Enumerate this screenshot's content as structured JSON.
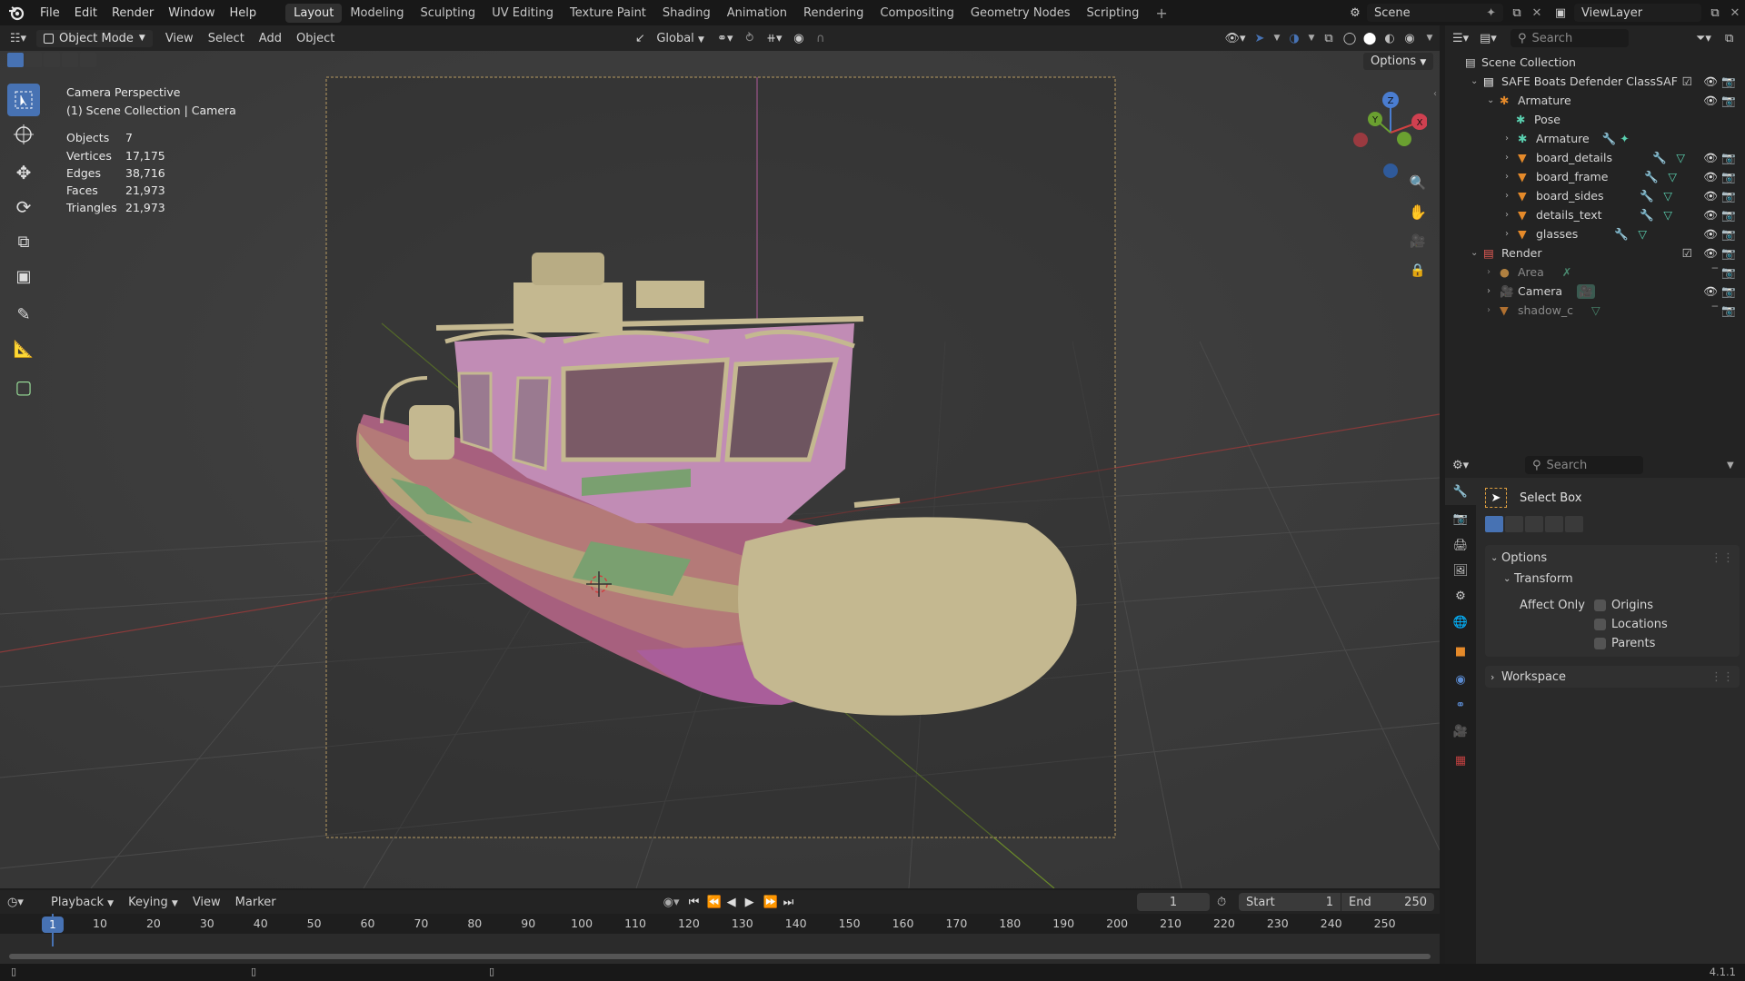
{
  "app": {
    "menus": [
      "File",
      "Edit",
      "Render",
      "Window",
      "Help"
    ]
  },
  "workspaces": [
    "Layout",
    "Modeling",
    "Sculpting",
    "UV Editing",
    "Texture Paint",
    "Shading",
    "Animation",
    "Rendering",
    "Compositing",
    "Geometry Nodes",
    "Scripting"
  ],
  "active_workspace": "Layout",
  "scene": {
    "name": "Scene",
    "view_layer": "ViewLayer"
  },
  "viewport": {
    "mode": "Object Mode",
    "menus": [
      "View",
      "Select",
      "Add",
      "Object"
    ],
    "transform_orientation": "Global",
    "options_label": "Options",
    "overlay_title": "Camera Perspective",
    "overlay_subtitle": "(1) Scene Collection | Camera",
    "stats": [
      {
        "label": "Objects",
        "value": "7"
      },
      {
        "label": "Vertices",
        "value": "17,175"
      },
      {
        "label": "Edges",
        "value": "38,716"
      },
      {
        "label": "Faces",
        "value": "21,973"
      },
      {
        "label": "Triangles",
        "value": "21,973"
      }
    ],
    "gizmo": {
      "z": "Z",
      "y": "Y",
      "x": "X"
    }
  },
  "outliner": {
    "search_placeholder": "Search",
    "root": "Scene Collection",
    "rows": [
      {
        "label": "SAFE Boats Defender ClassSAF",
        "type": "collection",
        "indent": 0
      },
      {
        "label": "Armature",
        "type": "armature",
        "indent": 1
      },
      {
        "label": "Pose",
        "type": "pose",
        "indent": 2
      },
      {
        "label": "Armature",
        "type": "armature-data",
        "indent": 2
      },
      {
        "label": "board_details",
        "type": "mesh",
        "indent": 2
      },
      {
        "label": "board_frame",
        "type": "mesh",
        "indent": 2
      },
      {
        "label": "board_sides",
        "type": "mesh",
        "indent": 2
      },
      {
        "label": "details_text",
        "type": "mesh",
        "indent": 2
      },
      {
        "label": "glasses",
        "type": "mesh",
        "indent": 2
      },
      {
        "label": "Render",
        "type": "collection",
        "indent": 0
      },
      {
        "label": "Area",
        "type": "light",
        "indent": 1
      },
      {
        "label": "Camera",
        "type": "camera",
        "indent": 1
      },
      {
        "label": "shadow_c",
        "type": "mesh",
        "indent": 1
      }
    ]
  },
  "properties": {
    "search_placeholder": "Search",
    "tool_name": "Select Box",
    "options_label": "Options",
    "transform_label": "Transform",
    "affect_only_label": "Affect Only",
    "affect_only": [
      "Origins",
      "Locations",
      "Parents"
    ],
    "workspace_label": "Workspace"
  },
  "timeline": {
    "menus": [
      "Playback",
      "Keying",
      "View",
      "Marker"
    ],
    "current_frame": "1",
    "start_label": "Start",
    "start": "1",
    "end_label": "End",
    "end": "250",
    "ticks": [
      "1",
      "10",
      "20",
      "30",
      "40",
      "50",
      "60",
      "70",
      "80",
      "90",
      "100",
      "110",
      "120",
      "130",
      "140",
      "150",
      "160",
      "170",
      "180",
      "190",
      "200",
      "210",
      "220",
      "230",
      "240",
      "250"
    ]
  },
  "status": {
    "version": "4.1.1"
  },
  "colors": {
    "accent": "#4772b3",
    "mesh": "#e58a2a",
    "collection_white": "#e8e8e8",
    "render_collection": "#e55b55"
  }
}
